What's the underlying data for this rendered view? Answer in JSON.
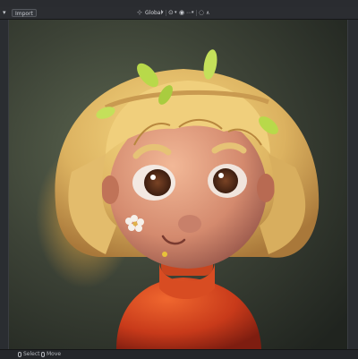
{
  "toolbar": {
    "import_label": "Import",
    "orientation_label": "Global",
    "orientation_icon": "transform-orientation-icon",
    "pivot_icon": "pivot-point-icon",
    "snap_icon": "snap-icon",
    "proportional_icon": "proportional-editing-icon"
  },
  "viewport": {
    "content": "3D render of a stylized cartoon girl with blonde bob hair, leafy crown and red turtleneck"
  },
  "status": {
    "select_label": "Select",
    "move_label": "Move"
  },
  "colors": {
    "accent": "#4a90d9",
    "hair": "#e8c46a",
    "sweater": "#d2401f",
    "skin": "#e8a07e",
    "leaves": "#b9d94a",
    "background": "#3d4438"
  }
}
